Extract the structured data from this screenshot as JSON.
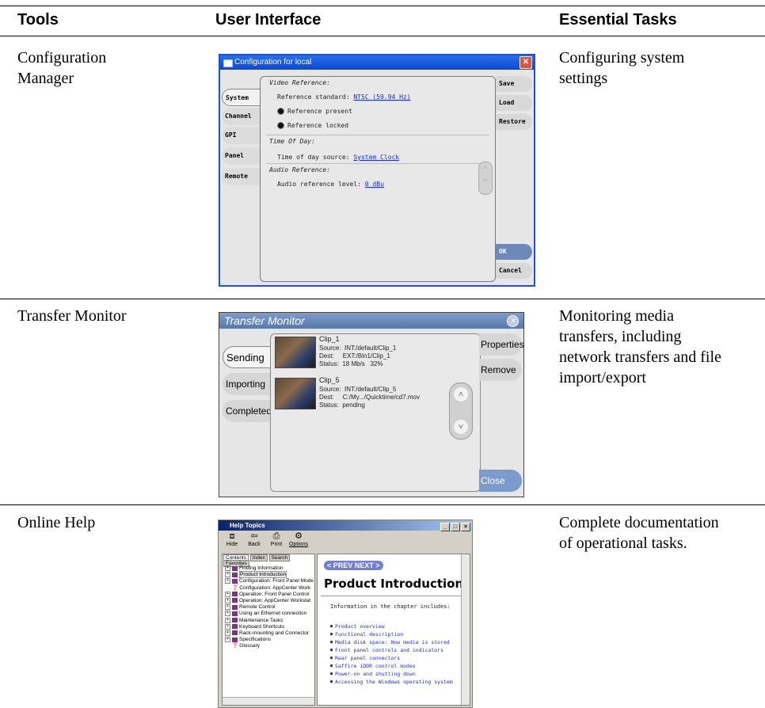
{
  "table": {
    "headers": {
      "tools": "Tools",
      "ui": "User Interface",
      "tasks": "Essential Tasks"
    },
    "rows": [
      {
        "tool": "Configuration\nManager",
        "task": "Configuring system\nsettings"
      },
      {
        "tool": "Transfer Monitor",
        "task": "Monitoring media\ntransfers, including\nnetwork transfers and file\nimport/export"
      },
      {
        "tool": "Online Help",
        "task": "Complete documentation\nof operational tasks."
      }
    ]
  },
  "config_window": {
    "title": "Configuration for local",
    "close": "✕",
    "tabs": [
      "System",
      "Channel",
      "GPI",
      "Panel",
      "Remote"
    ],
    "active_tab": "System",
    "buttons": [
      "Save",
      "Load",
      "Restore",
      "OK",
      "Cancel"
    ],
    "video_reference": "Video Reference:",
    "ref_standard_label": "Reference standard:",
    "ref_standard_value": "NTSC (59.94 Hz)",
    "ref_present": "Reference present",
    "ref_locked": "Reference locked",
    "time_of_day": "Time Of Day:",
    "tod_source_label": "Time of day source:",
    "tod_source_value": "System Clock",
    "audio_reference": "Audio Reference:",
    "audio_level_label": "Audio reference level:",
    "audio_level_value": "0 dBu"
  },
  "transfer_monitor": {
    "title": "Transfer Monitor",
    "tabs": [
      "Sending",
      "Importing",
      "Completed"
    ],
    "active_tab": "Sending",
    "buttons": [
      "Properties",
      "Remove",
      "Close"
    ],
    "clips": [
      {
        "name": "Clip_1",
        "details": "Source:  INT:/default/Clip_1\nDest:     EXT:/Bin1/Clip_1\nStatus:  18 Mb/s   32%"
      },
      {
        "name": "Clip_5",
        "details": "Source:  INT:/default/Clip_5\nDest:     C:/My.../Quicktime/cd7.mov\nStatus:  pending"
      }
    ]
  },
  "help_window": {
    "title": "Help Topics",
    "toolbar": [
      {
        "label": "Hide",
        "icon": "hide-icon"
      },
      {
        "label": "Back",
        "icon": "back-icon"
      },
      {
        "label": "Print",
        "icon": "print-icon"
      },
      {
        "label": "Options",
        "icon": "options-icon"
      }
    ],
    "tabs": [
      "Contents",
      "Index",
      "Search",
      "Favorites"
    ],
    "tree": [
      "Finding Information",
      "Product Introduction",
      "Configuration: Front Panel Mode",
      "Configuration: AppCenter Work",
      "Operation: Front Panel Control",
      "Operation: AppCenter Workstat",
      "Remote Control",
      "Using an Ethernet connection",
      "Maintenance Tasks",
      "Keyboard Shortcuts",
      "Rack-mounting and Connector",
      "Specifications",
      "Glossary"
    ],
    "prevnext": "< PREV NEXT >",
    "page_title": "Product Introduction",
    "intro": "Information in the chapter includes:",
    "links": [
      "Product overview",
      "Functional description",
      "Media disk space: How media is stored",
      "Front panel controls and indicators",
      "Rear panel connectors",
      "Saffire iDDR control modes",
      "Power-on and shutting down",
      "Accessing the Windows operating system"
    ]
  }
}
